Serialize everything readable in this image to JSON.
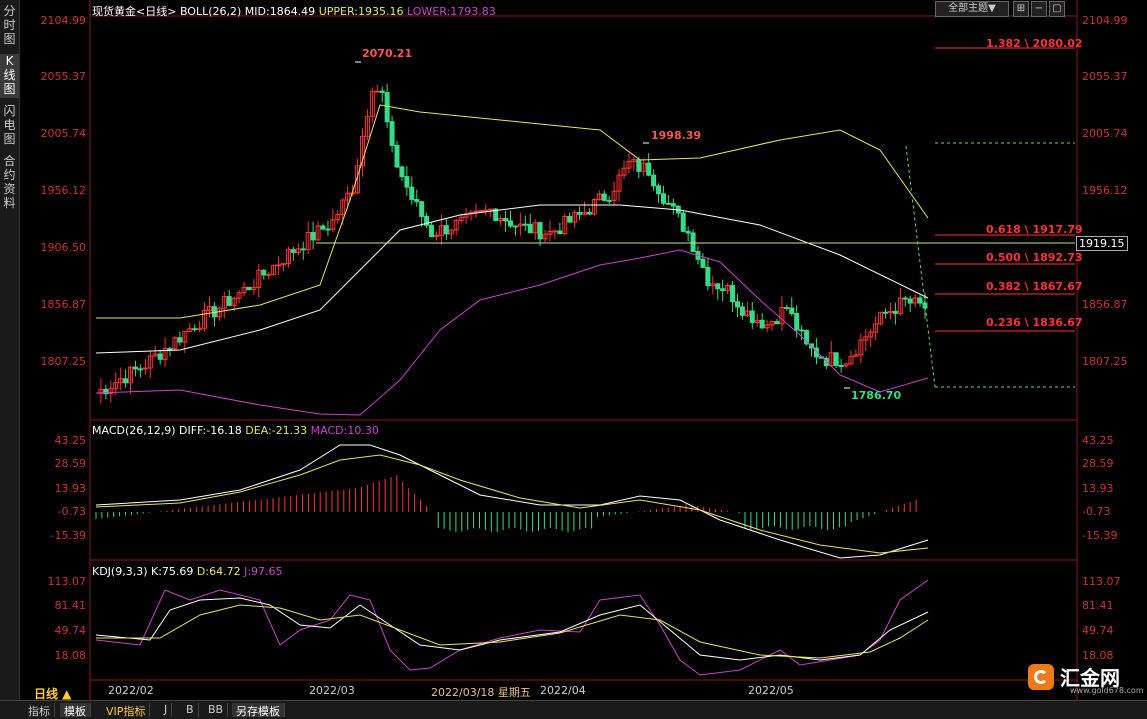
{
  "sidebar": {
    "tabs": [
      {
        "label": "分时图",
        "active": false
      },
      {
        "label": "K线图",
        "active": true
      },
      {
        "label": "闪电图",
        "active": false
      },
      {
        "label": "合约资料",
        "active": false
      }
    ]
  },
  "main_header": {
    "symbol": "现货黄金",
    "period": "<日线>",
    "boll_label": "BOLL(26,2)",
    "mid": "MID:1864.49",
    "upper": "UPPER:1935.16",
    "lower": "LOWER:1793.83"
  },
  "toolbar": {
    "theme_label": "全部主题▼"
  },
  "price_axis": {
    "ticks": [
      "2104.99",
      "2055.37",
      "2005.74",
      "1956.12",
      "1906.50",
      "1856.87",
      "1807.25"
    ]
  },
  "annotations": {
    "high1": "2070.21",
    "high2": "1998.39",
    "low1": "1786.70",
    "hline": "1919.15"
  },
  "fibonacci": [
    {
      "label": "1.382 \\ 2080.02",
      "color": "#ff3333"
    },
    {
      "label": "0.618 \\ 1917.79",
      "color": "#ff3333"
    },
    {
      "label": "0.500 \\ 1892.73",
      "color": "#ff3333"
    },
    {
      "label": "0.382 \\ 1867.67",
      "color": "#ff3333"
    },
    {
      "label": "0.236 \\ 1836.67",
      "color": "#ff3333"
    }
  ],
  "macd": {
    "header": "MACD(26,12,9)",
    "diff": "DIFF:-16.18",
    "dea": "DEA:-21.33",
    "macd": "MACD:10.30",
    "ticks": [
      "43.25",
      "28.59",
      "13.93",
      "-0.73",
      "-15.39"
    ]
  },
  "kdj": {
    "header": "KDJ(9,3,3)",
    "k": "K:75.69",
    "d": "D:64.72",
    "j": "J:97.65",
    "ticks": [
      "113.07",
      "81.41",
      "49.74",
      "18.08"
    ]
  },
  "time_axis": {
    "period_label": "日线 ▲",
    "labels": [
      "2022/02",
      "2022/03",
      "2022/03/18 星期五",
      "2022/04",
      "2022/05"
    ]
  },
  "bottom_tabs": [
    {
      "label": "指标",
      "active": false
    },
    {
      "label": "模板",
      "active": true
    },
    {
      "label": "VIP指标",
      "active": false
    },
    {
      "label": "J",
      "active": false
    },
    {
      "label": "B",
      "active": false
    },
    {
      "label": "BB",
      "active": false
    },
    {
      "label": "另存模板",
      "active": true
    }
  ],
  "logo": {
    "name": "汇金网",
    "url": "www.gold678.com"
  },
  "colors": {
    "up": "#ff3333",
    "down": "#33dd88",
    "mid_line": "#ffffff",
    "upper_line": "#e6e65c",
    "lower_line": "#cc44cc",
    "axis_text": "#cc3333"
  }
}
